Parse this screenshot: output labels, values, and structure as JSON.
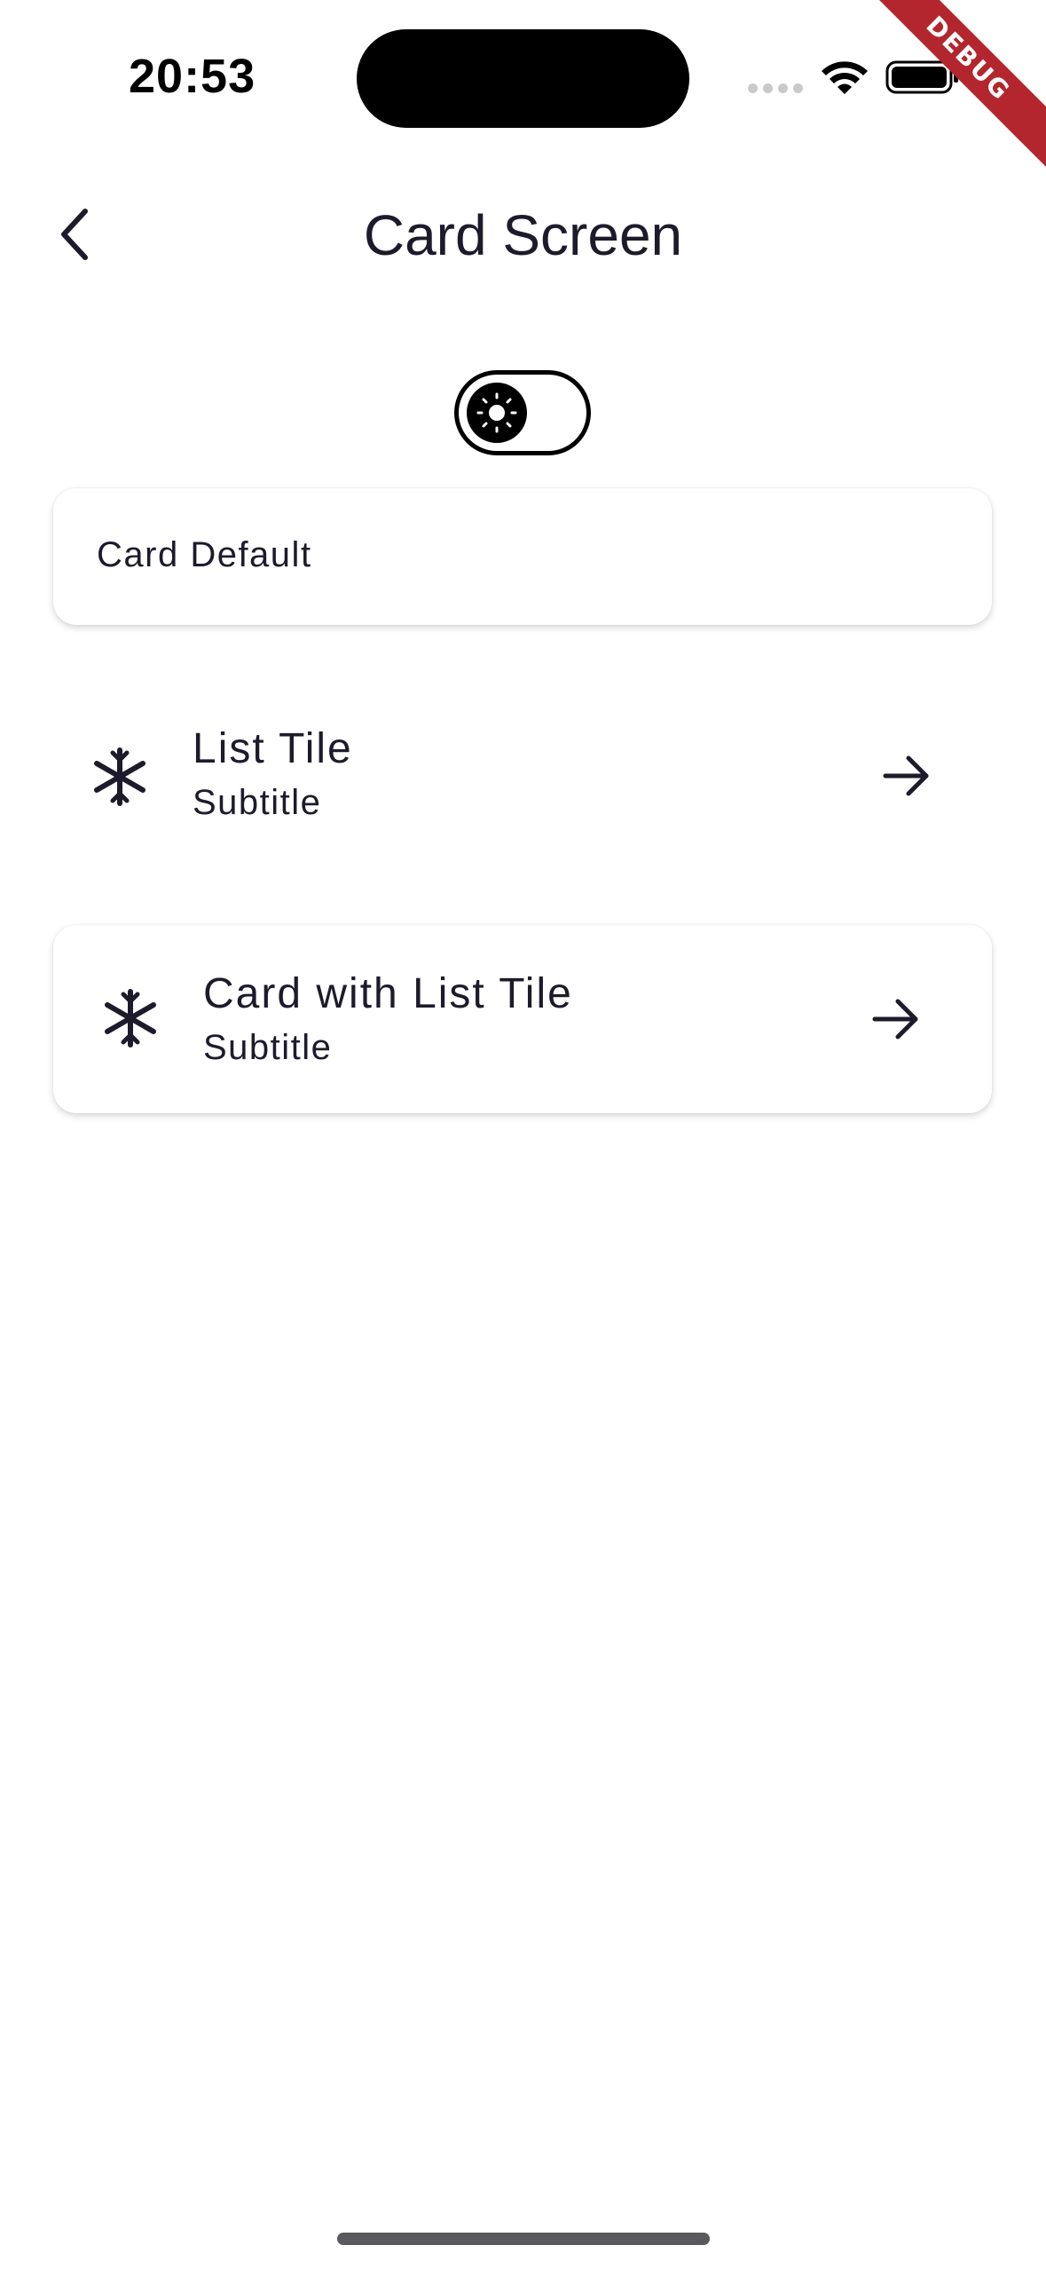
{
  "status_bar": {
    "time": "20:53",
    "debug_label": "DEBUG"
  },
  "app_bar": {
    "title": "Card Screen",
    "back_icon": "chevron-left-icon"
  },
  "theme_toggle": {
    "icon": "sun-icon",
    "state": "light"
  },
  "cards": {
    "default_label": "Card Default",
    "list_tile": {
      "title": "List Tile",
      "subtitle": "Subtitle",
      "leading_icon": "snowflake-icon",
      "trailing_icon": "arrow-right-icon"
    },
    "card_list_tile": {
      "title": "Card with List Tile",
      "subtitle": "Subtitle",
      "leading_icon": "snowflake-icon",
      "trailing_icon": "arrow-right-icon"
    }
  },
  "colors": {
    "text": "#1d1b2b",
    "debug_banner": "#b3262e",
    "background": "#ffffff"
  }
}
